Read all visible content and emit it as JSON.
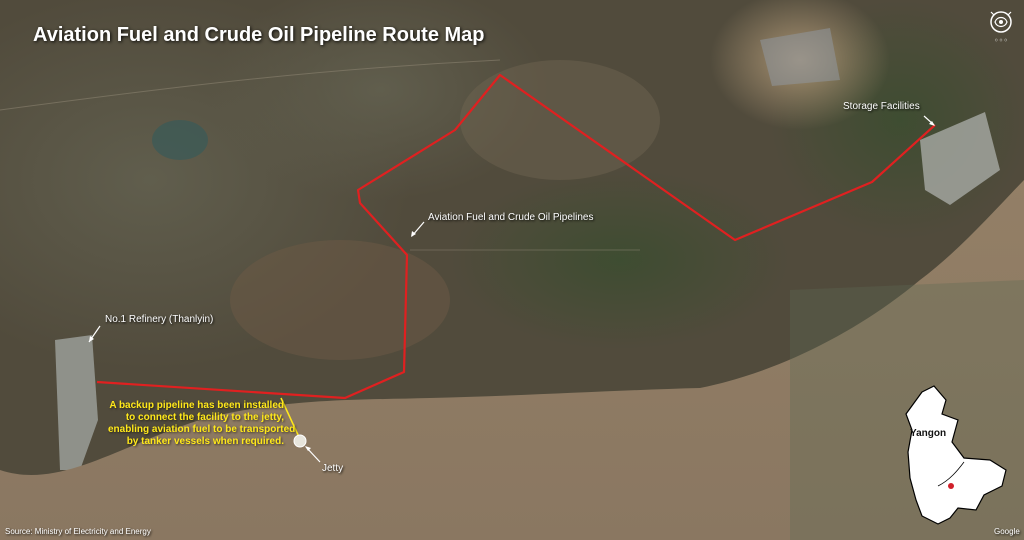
{
  "title": "Aviation Fuel and Crude Oil Pipeline Route Map",
  "labels": {
    "refinery": "No.1 Refinery (Thanlyin)",
    "pipelines": "Aviation Fuel and Crude Oil Pipelines",
    "storage": "Storage Facilities",
    "jetty": "Jetty"
  },
  "note_lines": [
    "A backup pipeline has been installed",
    "to connect the facility to the jetty,",
    "enabling aviation fuel to be transported",
    "by tanker vessels when required."
  ],
  "inset": {
    "region": "Yangon"
  },
  "source": "Source: Ministry of Electricity and Energy",
  "attribution": "Google",
  "colors": {
    "pipeline": "#e02020",
    "note": "#ffe81a",
    "river": "#8d7b62",
    "land": "#4f4a3b",
    "inset_fill": "#ffffff",
    "inset_marker": "#d0202a"
  },
  "icons": [
    "logo-emblem-icon",
    "arrow-icon",
    "location-marker-icon"
  ]
}
